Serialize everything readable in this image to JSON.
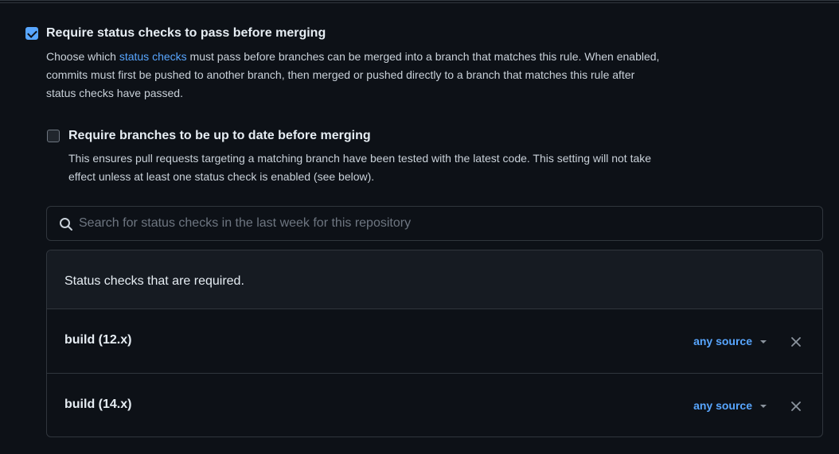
{
  "status_checks_rule": {
    "checked": true,
    "title": "Require status checks to pass before merging",
    "desc_prefix": "Choose which ",
    "desc_link": "status checks",
    "desc_line1_rest": " must pass before branches can be merged into a branch that matches this rule. When enabled,",
    "desc_line2": "commits must first be pushed to another branch, then merged or pushed directly to a branch that matches this rule after",
    "desc_line3": "status checks have passed."
  },
  "up_to_date_rule": {
    "checked": false,
    "title": "Require branches to be up to date before merging",
    "desc_line1": "This ensures pull requests targeting a matching branch have been tested with the latest code. This setting will not take",
    "desc_line2": "effect unless at least one status check is enabled (see below)."
  },
  "search": {
    "placeholder": "Search for status checks in the last week for this repository",
    "value": ""
  },
  "required_checks": {
    "header": "Status checks that are required.",
    "items": [
      {
        "name": "build (12.x)",
        "source": "any source"
      },
      {
        "name": "build (14.x)",
        "source": "any source"
      }
    ]
  },
  "colors": {
    "background": "#0d1117",
    "panel": "#161b22",
    "border": "#30363d",
    "link": "#58a6ff",
    "text": "#e6edf3"
  },
  "icons": {
    "search": "search-icon",
    "close": "close-icon",
    "caret": "caret-down-icon",
    "checkbox_checked": "checkbox-checked",
    "checkbox_unchecked": "checkbox-unchecked"
  }
}
